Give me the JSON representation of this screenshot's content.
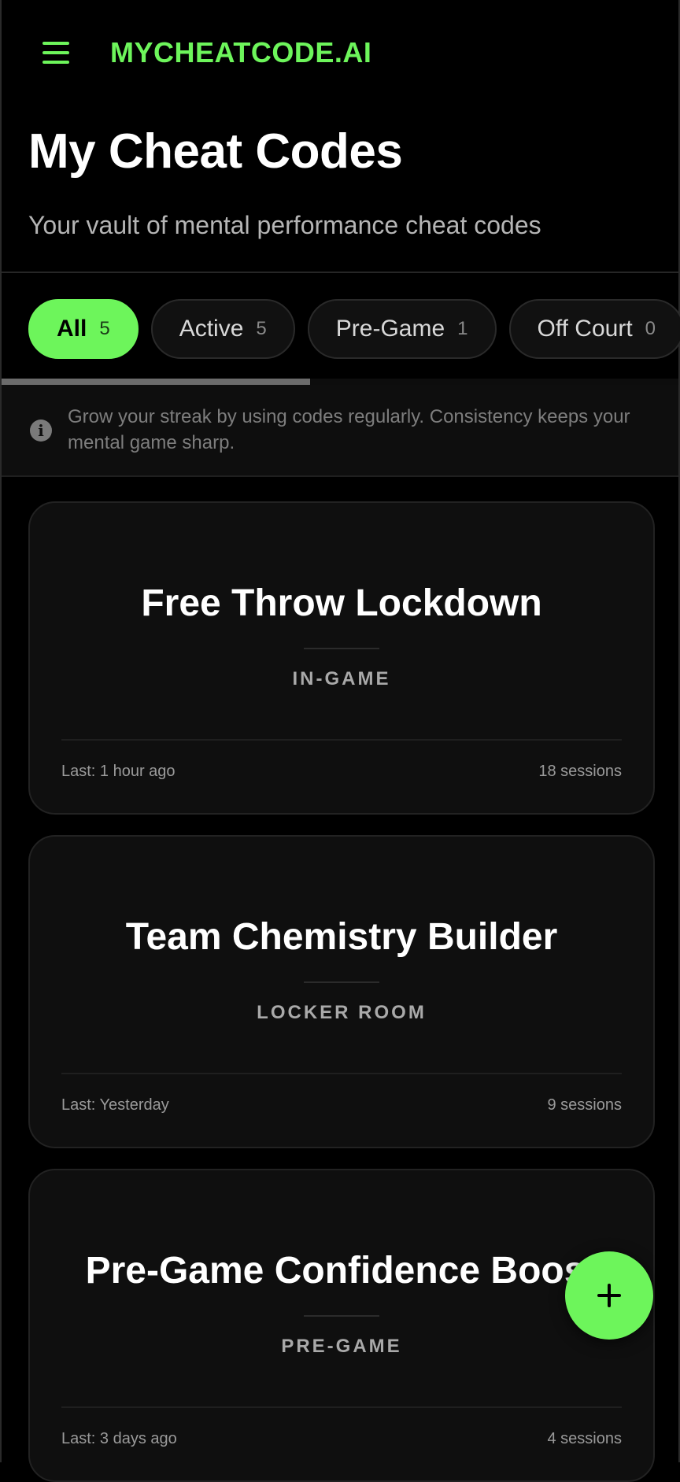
{
  "header": {
    "brand": "MYCHEATCODE.AI",
    "icon": "menu-icon"
  },
  "page": {
    "title": "My Cheat Codes",
    "subtitle": "Your vault of mental performance cheat codes"
  },
  "tabs": [
    {
      "label": "All",
      "count": "5",
      "active": true
    },
    {
      "label": "Active",
      "count": "5",
      "active": false
    },
    {
      "label": "Pre-Game",
      "count": "1",
      "active": false
    },
    {
      "label": "Off Court",
      "count": "0",
      "active": false
    }
  ],
  "info": {
    "icon": "info-icon",
    "text": "Grow your streak by using codes regularly. Consistency keeps your mental game sharp."
  },
  "cards": [
    {
      "title": "Free Throw Lockdown",
      "tag": "IN-GAME",
      "last": "Last: 1 hour ago",
      "sessions": "18 sessions"
    },
    {
      "title": "Team Chemistry Builder",
      "tag": "LOCKER ROOM",
      "last": "Last: Yesterday",
      "sessions": "9 sessions"
    },
    {
      "title": "Pre-Game Confidence Boost",
      "tag": "PRE-GAME",
      "last": "Last: 3 days ago",
      "sessions": "4 sessions"
    }
  ],
  "fab": {
    "icon": "plus-icon"
  },
  "colors": {
    "accent": "#6df55b",
    "background": "#000000",
    "card": "#0f0f0f"
  }
}
